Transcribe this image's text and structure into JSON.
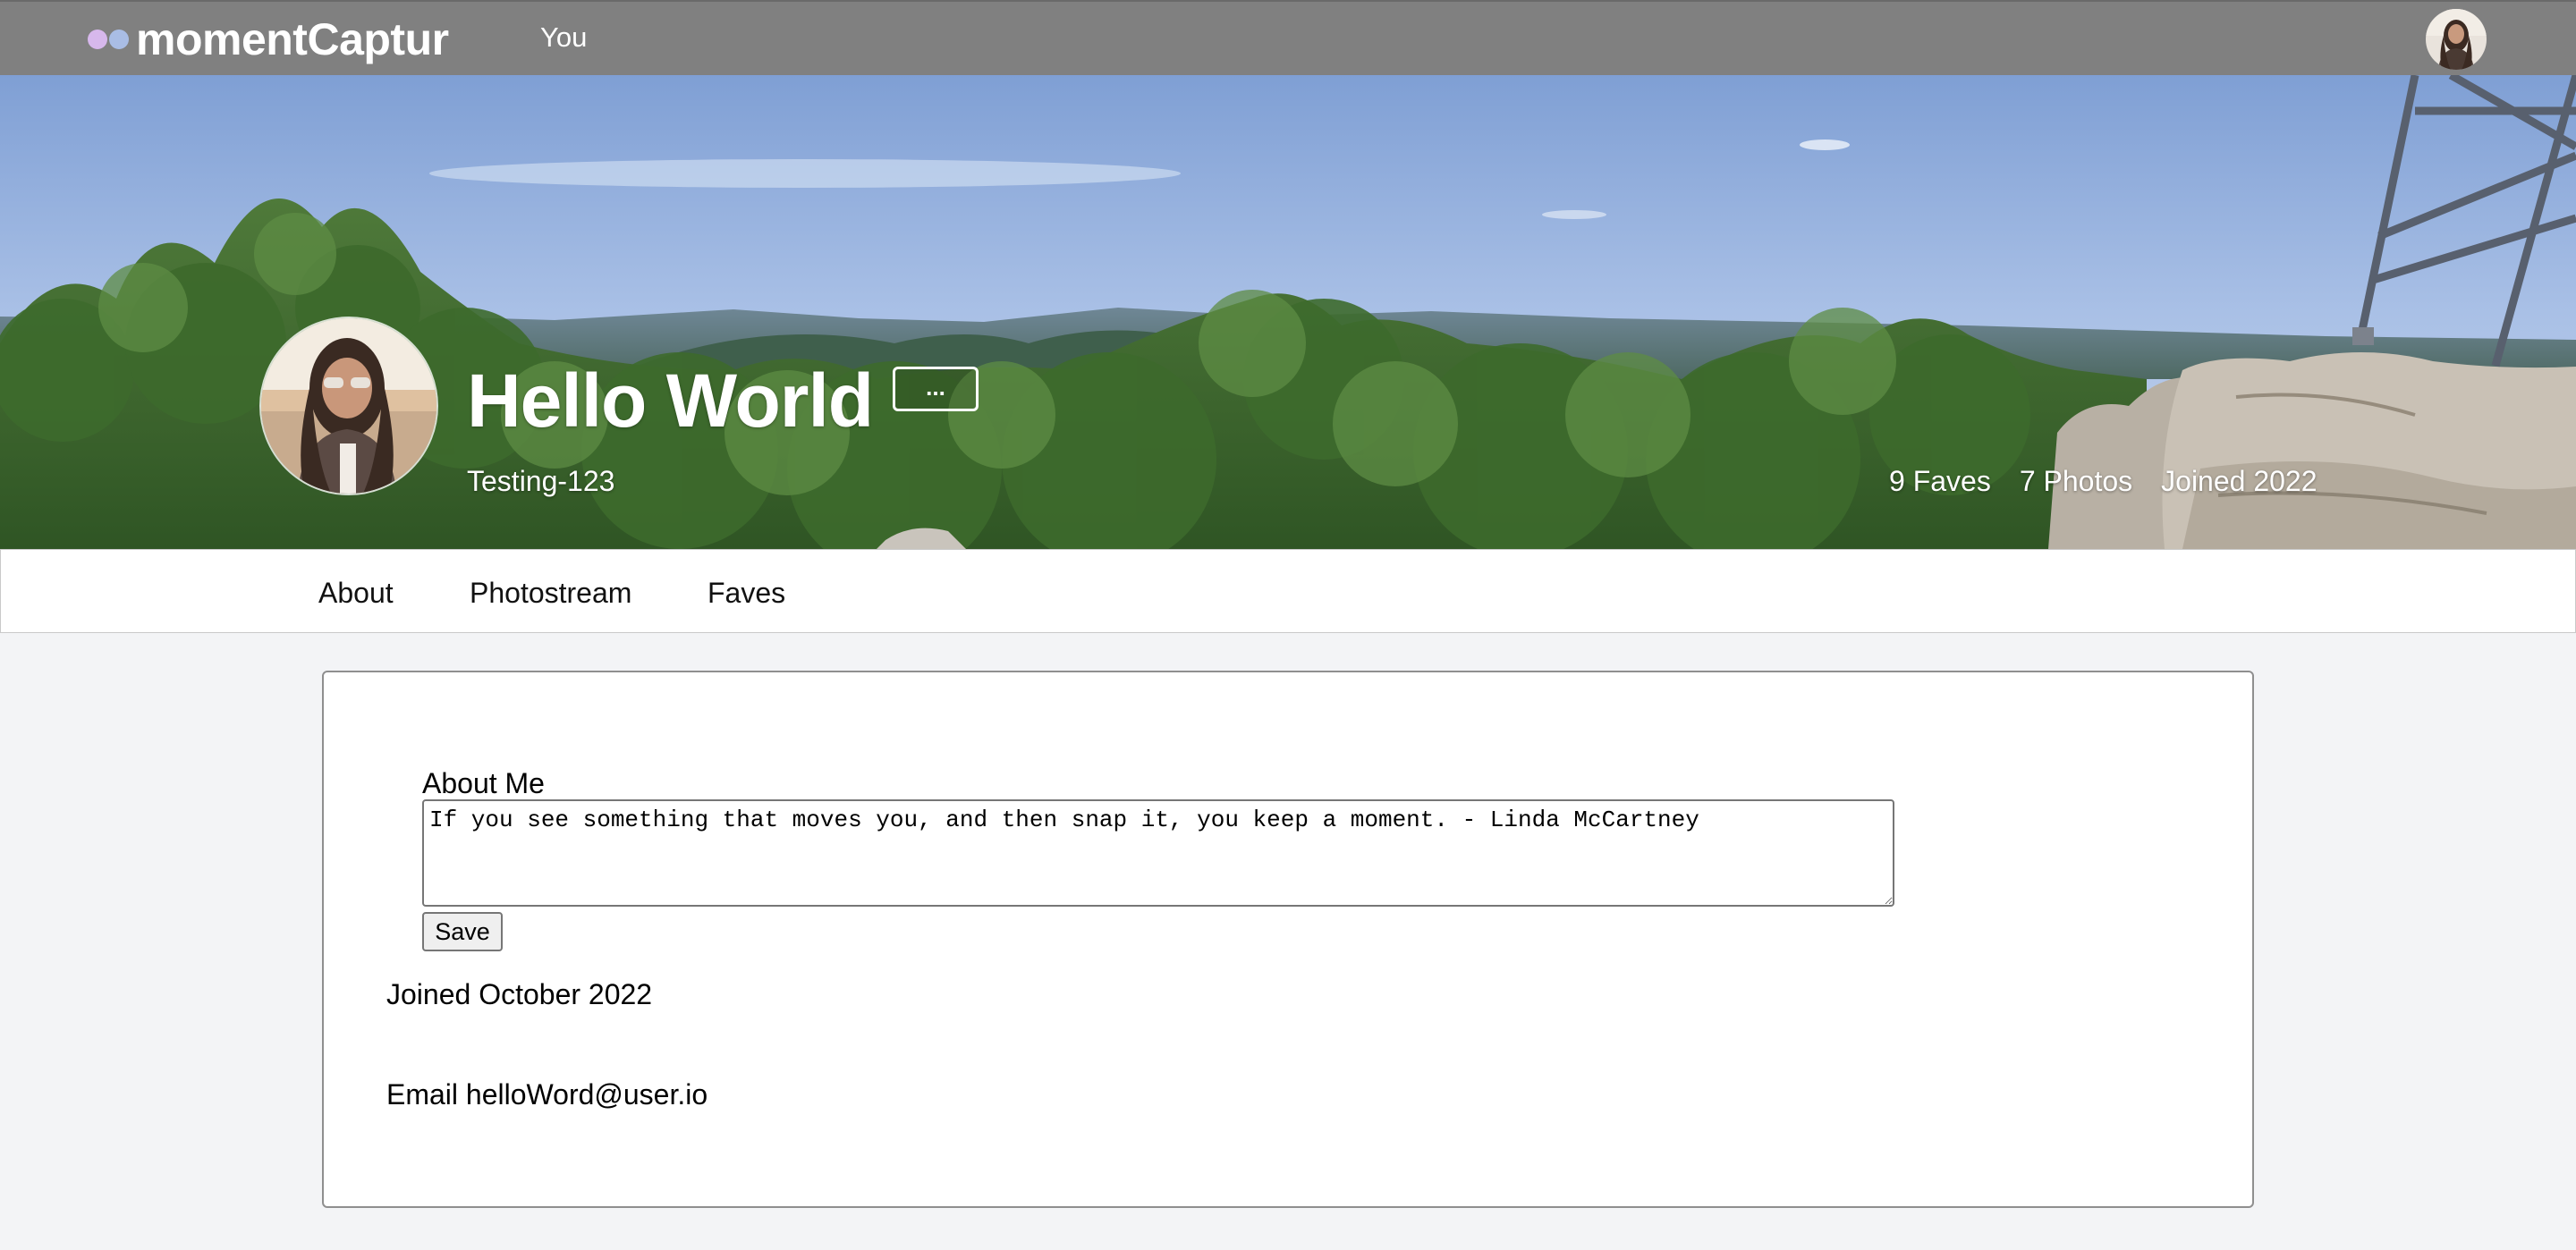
{
  "topnav": {
    "logo_text": "momentCaptur",
    "nav_you": "You",
    "avatar_icon": "user-avatar"
  },
  "profile": {
    "name": "Hello World",
    "more_label": "...",
    "username": "Testing-123",
    "stats": {
      "faves": "9 Faves",
      "photos": "7 Photos",
      "joined": "Joined 2022"
    }
  },
  "tabs": [
    {
      "label": "About"
    },
    {
      "label": "Photostream"
    },
    {
      "label": "Faves"
    }
  ],
  "about": {
    "label": "About Me",
    "text": "If you see something that moves you, and then snap it, you keep a moment. - Linda McCartney",
    "save_label": "Save",
    "joined": "Joined October 2022",
    "email": "Email helloWord@user.io"
  },
  "colors": {
    "topnav_bg": "#808080",
    "page_bg": "#f3f4f6",
    "logo_dot_1": "#d7b8ec",
    "logo_dot_2": "#a9bde5"
  }
}
